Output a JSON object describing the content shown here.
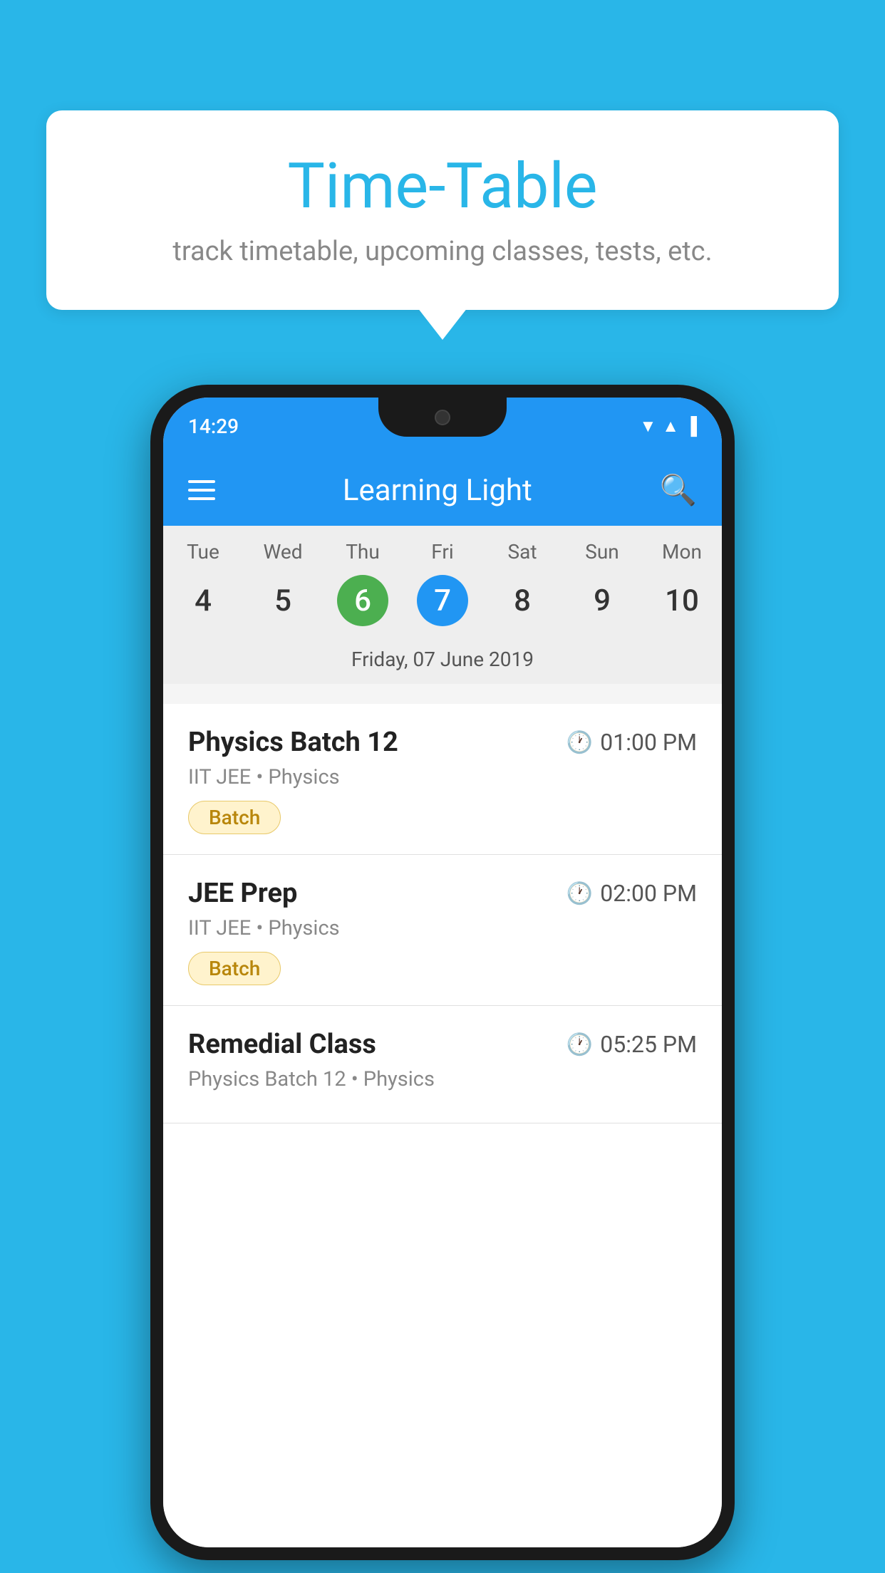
{
  "background": {
    "color": "#29b6e8"
  },
  "bubble": {
    "title": "Time-Table",
    "subtitle": "track timetable, upcoming classes, tests, etc."
  },
  "phone": {
    "status_bar": {
      "time": "14:29"
    },
    "app_bar": {
      "title": "Learning Light"
    },
    "calendar": {
      "days": [
        {
          "short": "Tue",
          "num": "4"
        },
        {
          "short": "Wed",
          "num": "5"
        },
        {
          "short": "Thu",
          "num": "6",
          "state": "green"
        },
        {
          "short": "Fri",
          "num": "7",
          "state": "blue"
        },
        {
          "short": "Sat",
          "num": "8"
        },
        {
          "short": "Sun",
          "num": "9"
        },
        {
          "short": "Mon",
          "num": "10"
        }
      ],
      "selected_date": "Friday, 07 June 2019"
    },
    "schedule": [
      {
        "title": "Physics Batch 12",
        "time": "01:00 PM",
        "subtitle": "IIT JEE • Physics",
        "badge": "Batch"
      },
      {
        "title": "JEE Prep",
        "time": "02:00 PM",
        "subtitle": "IIT JEE • Physics",
        "badge": "Batch"
      },
      {
        "title": "Remedial Class",
        "time": "05:25 PM",
        "subtitle": "Physics Batch 12 • Physics",
        "badge": null
      }
    ]
  }
}
